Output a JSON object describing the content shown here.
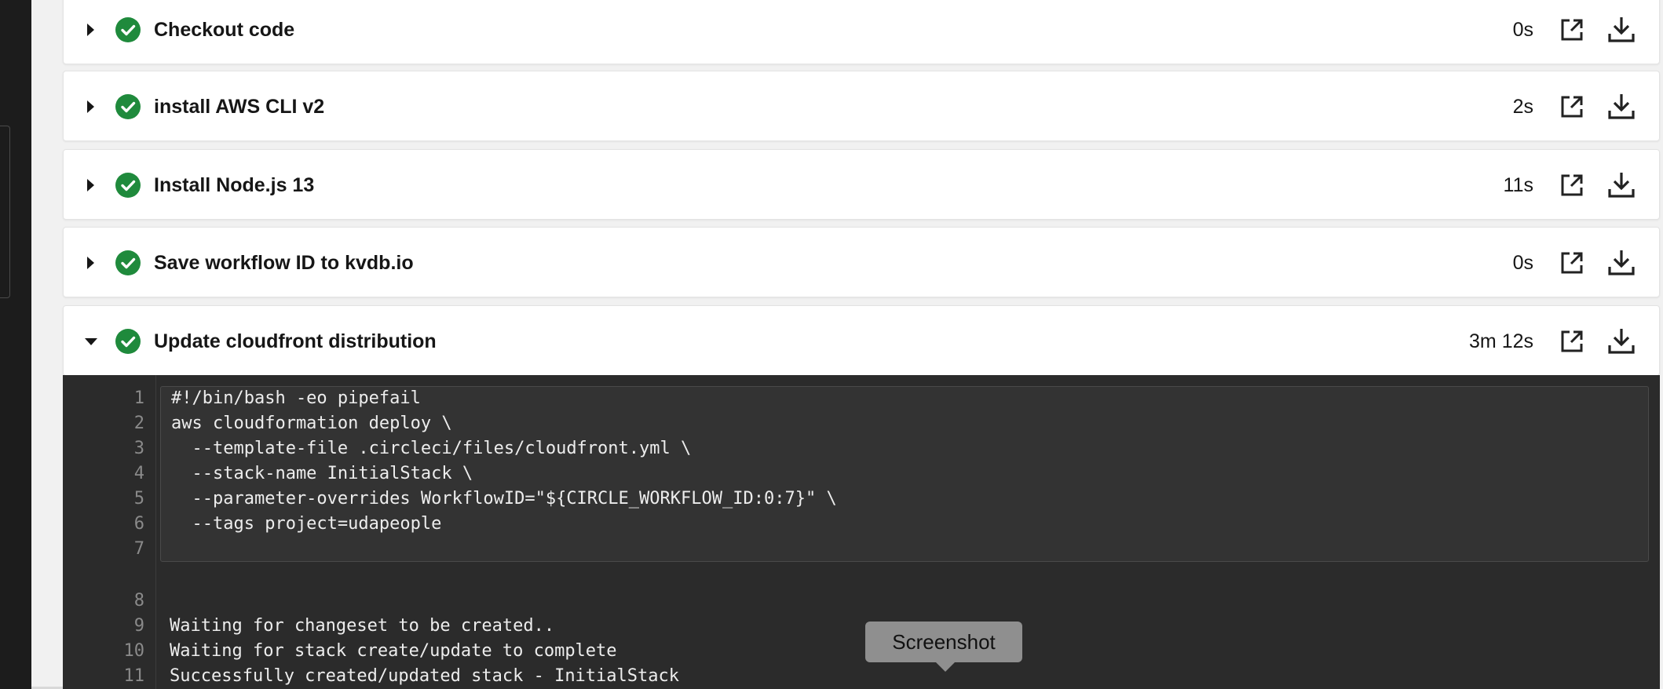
{
  "colors": {
    "success": "#1f8a3c",
    "log_bg": "#2b2b2b"
  },
  "steps": [
    {
      "title": "Checkout code",
      "duration": "0s",
      "status": "success"
    },
    {
      "title": "install AWS CLI v2",
      "duration": "2s",
      "status": "success"
    },
    {
      "title": "Install Node.js 13",
      "duration": "11s",
      "status": "success"
    },
    {
      "title": "Save workflow ID to kvdb.io",
      "duration": "0s",
      "status": "success"
    },
    {
      "title": "Update cloudfront distribution",
      "duration": "3m 12s",
      "status": "success",
      "expanded": true
    }
  ],
  "log": {
    "script_lines": [
      {
        "n": "1",
        "text": "#!/bin/bash -eo pipefail"
      },
      {
        "n": "2",
        "text": "aws cloudformation deploy \\"
      },
      {
        "n": "3",
        "text": "  --template-file .circleci/files/cloudfront.yml \\"
      },
      {
        "n": "4",
        "text": "  --stack-name InitialStack \\"
      },
      {
        "n": "5",
        "text": "  --parameter-overrides WorkflowID=\"${CIRCLE_WORKFLOW_ID:0:7}\" \\"
      },
      {
        "n": "6",
        "text": "  --tags project=udapeople"
      },
      {
        "n": "7",
        "text": ""
      }
    ],
    "output_lines": [
      {
        "n": "8",
        "text": ""
      },
      {
        "n": "9",
        "text": "Waiting for changeset to be created.."
      },
      {
        "n": "10",
        "text": "Waiting for stack create/update to complete"
      },
      {
        "n": "11",
        "text": "Successfully created/updated stack - InitialStack"
      }
    ]
  },
  "tooltip": {
    "label": "Screenshot"
  },
  "icons": {
    "status": "check-circle-icon",
    "open": "open-external-icon",
    "download": "download-icon",
    "caret": "caret-icon"
  }
}
